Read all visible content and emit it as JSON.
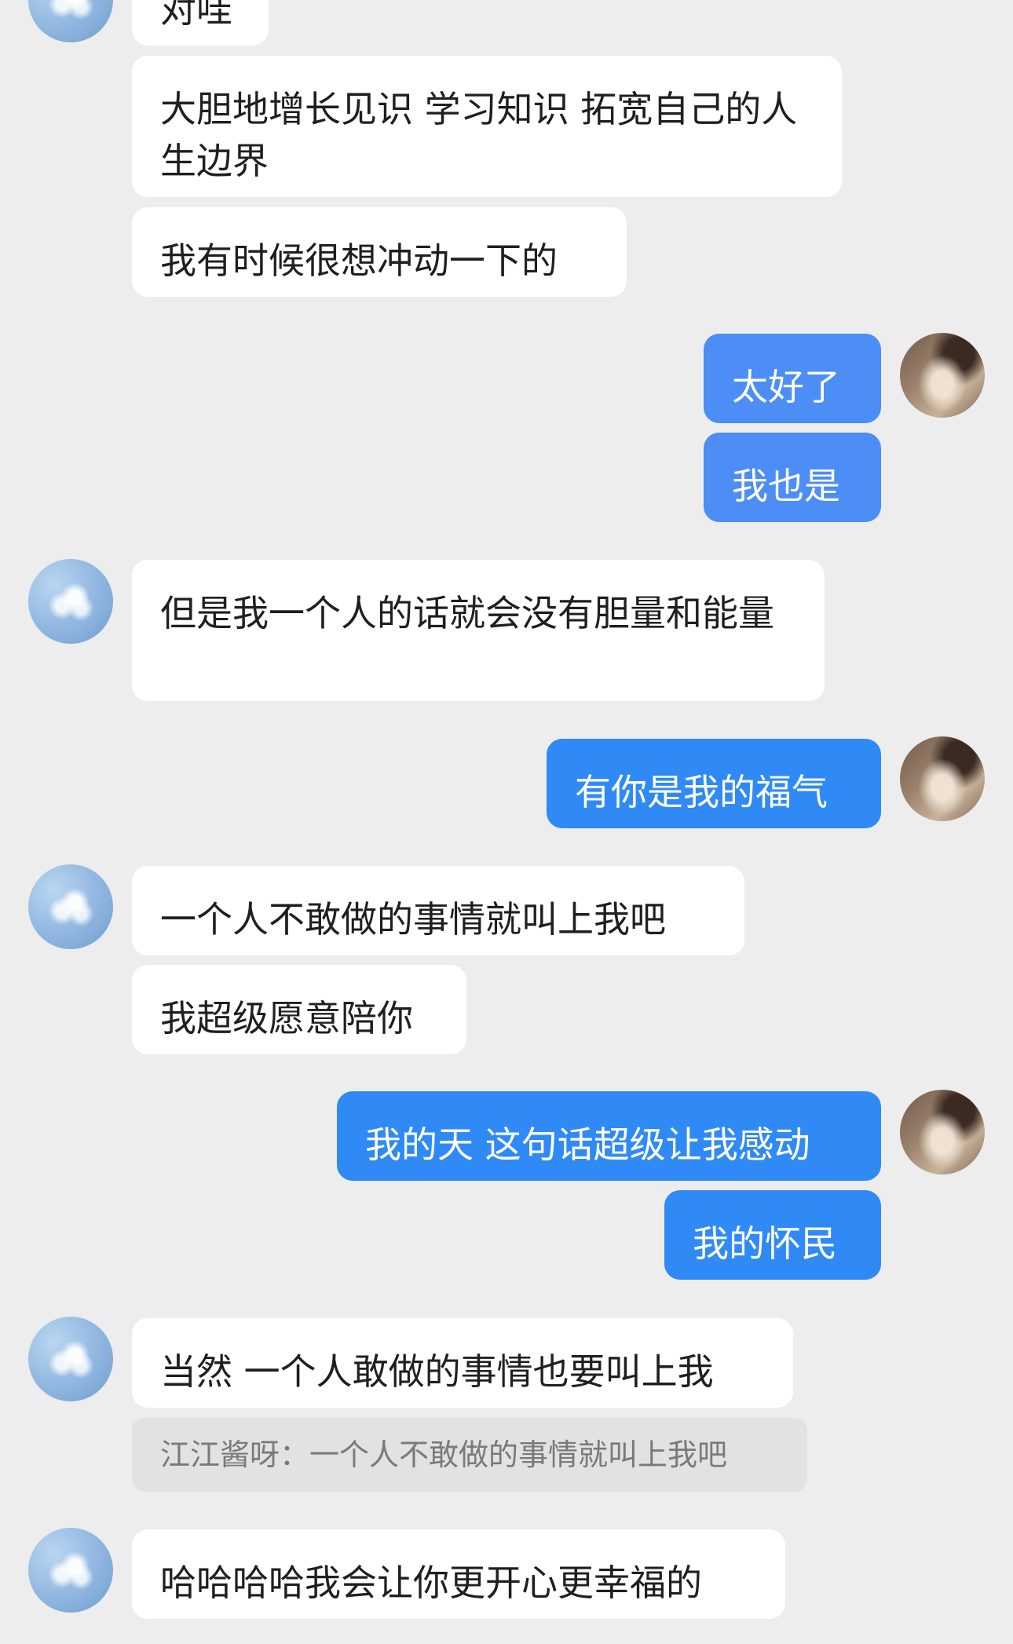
{
  "messages": [
    {
      "side": "in",
      "text": "对哇"
    },
    {
      "side": "in",
      "text": "大胆地增长见识 学习知识 拓宽自己的人生边界"
    },
    {
      "side": "in",
      "text": "我有时候很想冲动一下的"
    },
    {
      "side": "out",
      "text": "太好了"
    },
    {
      "side": "out",
      "text": "我也是"
    },
    {
      "side": "in",
      "text": "但是我一个人的话就会没有胆量和能量"
    },
    {
      "side": "out",
      "text": "有你是我的福气"
    },
    {
      "side": "in",
      "text": "一个人不敢做的事情就叫上我吧"
    },
    {
      "side": "in",
      "text": "我超级愿意陪你"
    },
    {
      "side": "out",
      "text": "我的天 这句话超级让我感动"
    },
    {
      "side": "out",
      "text": "我的怀民"
    },
    {
      "side": "in",
      "text": "当然 一个人敢做的事情也要叫上我"
    },
    {
      "side": "in",
      "text": "哈哈哈哈我会让你更开心更幸福的"
    }
  ],
  "quote": {
    "text": "江江酱呀：一个人不敢做的事情就叫上我吧"
  },
  "colors": {
    "background": "#EDEDED",
    "incoming_bubble": "#FFFFFF",
    "outgoing_bubble": "#4C8DF6",
    "quote_bubble": "#E2E2E2"
  }
}
